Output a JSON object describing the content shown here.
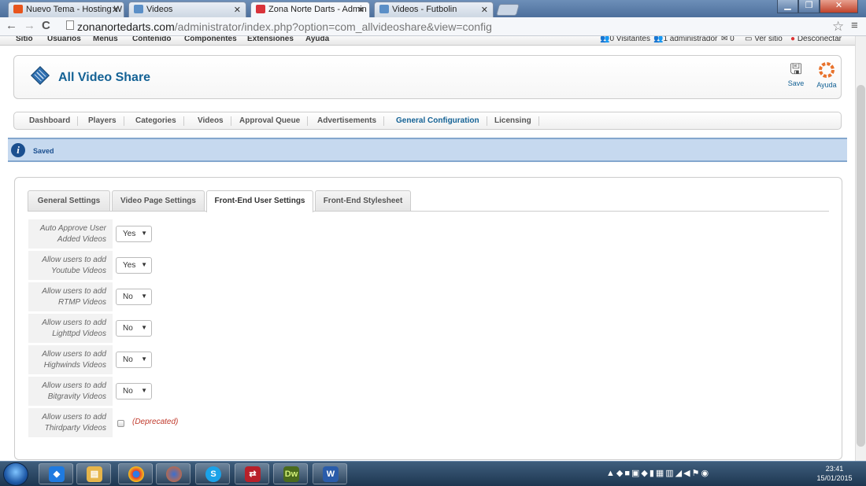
{
  "browser": {
    "tabs": [
      {
        "title": "Nuevo Tema - Hosting W",
        "favicon": "orange-w-icon",
        "active": false
      },
      {
        "title": "Videos",
        "favicon": "joomla-icon",
        "active": false
      },
      {
        "title": "Zona Norte Darts - Admin",
        "favicon": "darts-icon",
        "active": true
      },
      {
        "title": "Videos - Futbolin",
        "favicon": "joomla-icon",
        "active": false
      }
    ],
    "url_host": "zonanortedarts.com",
    "url_path": "/administrator/index.php?option=com_allvideoshare&view=config"
  },
  "adminbar": {
    "left": [
      "Sitio",
      "Usuarios",
      "Menús",
      "Contenido",
      "Componentes",
      "Extensiones",
      "Ayuda"
    ],
    "visitors": "0 Visitantes",
    "admins": "1 administrador",
    "messages": "0",
    "view_site": "Ver sitio",
    "logout": "Desconectar"
  },
  "header": {
    "title": "All Video Share",
    "save_label": "Save",
    "help_label": "Ayuda"
  },
  "submenu": [
    "Dashboard",
    "Players",
    "Categories",
    "Videos",
    "Approval Queue",
    "Advertisements",
    "General Configuration",
    "Licensing"
  ],
  "submenu_active": "General Configuration",
  "message": "Saved",
  "panel_tabs": [
    "General Settings",
    "Video Page Settings",
    "Front-End User Settings",
    "Front-End Stylesheet"
  ],
  "panel_tab_active": "Front-End User Settings",
  "settings": [
    {
      "label_1": "Auto Approve User",
      "label_2": "Added Videos",
      "value": "Yes"
    },
    {
      "label_1": "Allow users to add",
      "label_2": "Youtube Videos",
      "value": "Yes"
    },
    {
      "label_1": "Allow users to add",
      "label_2": "RTMP Videos",
      "value": "No"
    },
    {
      "label_1": "Allow users to add",
      "label_2": "Lighttpd Videos",
      "value": "No"
    },
    {
      "label_1": "Allow users to add",
      "label_2": "Highwinds Videos",
      "value": "No"
    },
    {
      "label_1": "Allow users to add",
      "label_2": "Bitgravity Videos",
      "value": "No"
    }
  ],
  "thirdparty": {
    "label_1": "Allow users to add",
    "label_2": "Thirdparty Videos",
    "note": "(Deprecated)",
    "checked": false
  },
  "taskbar": {
    "apps": [
      "dropbox-icon",
      "explorer-icon",
      "chrome-icon",
      "firefox-icon",
      "skype-icon",
      "filezilla-icon",
      "dreamweaver-icon",
      "word-icon"
    ],
    "dw_label": "Dw",
    "word_label": "W",
    "time": "23:41",
    "date": "15/01/2015"
  },
  "colors": {
    "accent": "#146295",
    "message_bg": "#c6d9ef",
    "deprecated": "#c0392b"
  }
}
